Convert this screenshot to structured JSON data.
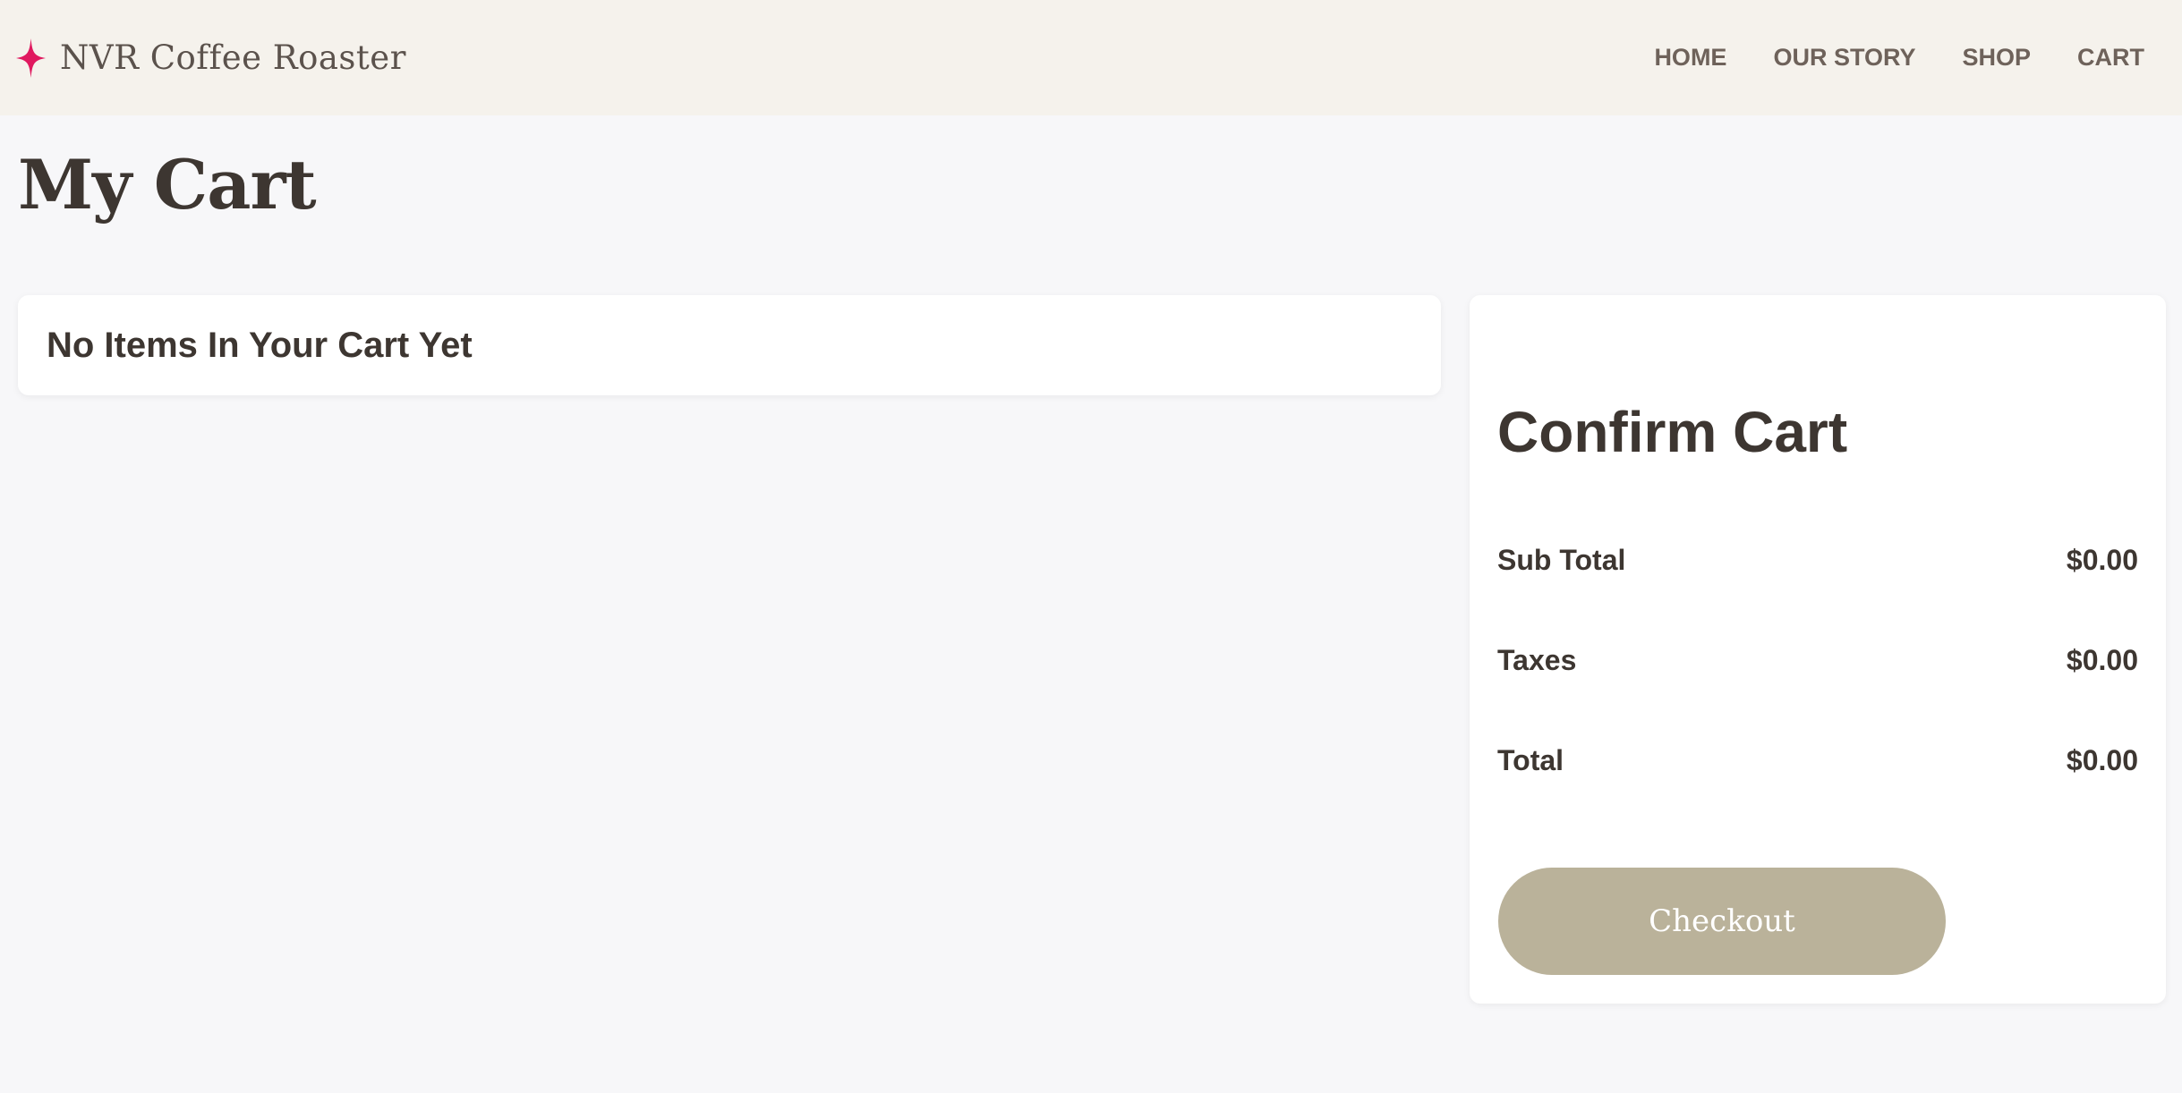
{
  "header": {
    "brand_name": "NVR Coffee Roaster",
    "brand_icon": "sparkle-icon",
    "brand_icon_color": "#e0195f",
    "nav": [
      {
        "label": "HOME"
      },
      {
        "label": "OUR STORY"
      },
      {
        "label": "SHOP"
      },
      {
        "label": "CART"
      }
    ]
  },
  "page": {
    "title": "My Cart"
  },
  "cart": {
    "empty_message": "No Items In Your Cart Yet"
  },
  "summary": {
    "title": "Confirm Cart",
    "rows": [
      {
        "label": "Sub Total",
        "value": "$0.00"
      },
      {
        "label": "Taxes",
        "value": "$0.00"
      },
      {
        "label": "Total",
        "value": "$0.00"
      }
    ],
    "checkout_label": "Checkout"
  },
  "colors": {
    "header_bg": "#f5f2ec",
    "page_bg": "#f7f7f9",
    "text": "#3d3631",
    "button_bg": "#bab29a"
  }
}
